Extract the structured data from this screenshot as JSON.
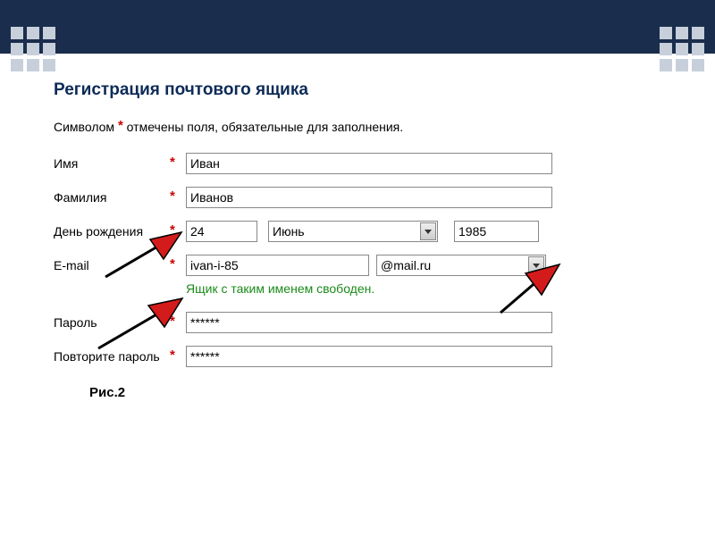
{
  "title": "Регистрация почтового ящика",
  "note_prefix": "Символом ",
  "note_suffix": " отмечены поля, обязательные для заполнения.",
  "asterisk": "*",
  "labels": {
    "first_name": "Имя",
    "last_name": "Фамилия",
    "birthday": "День рождения",
    "email": "E-mail",
    "password": "Пароль",
    "password_confirm": "Повторите пароль"
  },
  "values": {
    "first_name": "Иван",
    "last_name": "Иванов",
    "day": "24",
    "month": "Июнь",
    "year": "1985",
    "email_local": "ivan-i-85",
    "email_domain": "@mail.ru",
    "password": "******",
    "password_confirm": "******"
  },
  "status_message": "Ящик с таким именем свободен.",
  "figure_label": "Рис.2"
}
